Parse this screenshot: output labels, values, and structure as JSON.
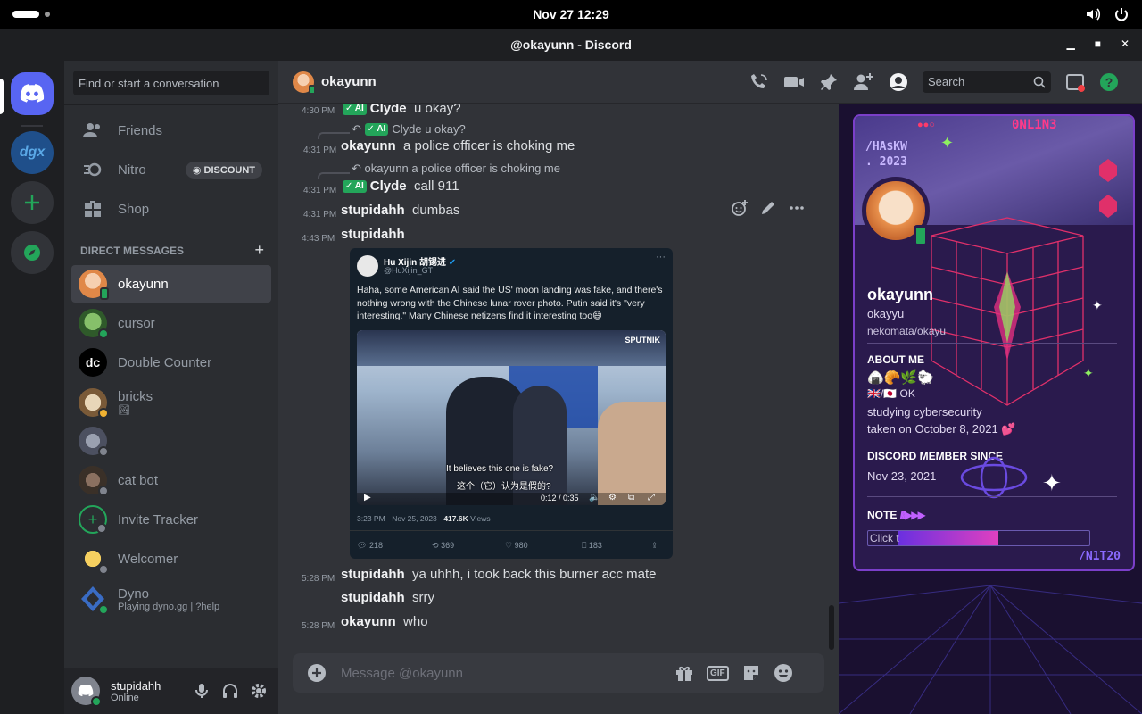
{
  "system": {
    "datetime": "Nov 27  12:29"
  },
  "window": {
    "title": "@okayunn - Discord"
  },
  "dm_sidebar": {
    "search_placeholder": "Find or start a conversation",
    "nav": [
      {
        "label": "Friends",
        "icon": "friends-icon"
      },
      {
        "label": "Nitro",
        "icon": "nitro-icon",
        "badge": "DISCOUNT"
      },
      {
        "label": "Shop",
        "icon": "shop-icon"
      }
    ],
    "dm_header": "DIRECT MESSAGES",
    "dms": [
      {
        "name": "okayunn",
        "sub": "",
        "status": "mobile",
        "color": "#f0a868"
      },
      {
        "name": "cursor",
        "sub": "",
        "status": "online",
        "color": "#3ba55c"
      },
      {
        "name": "Double Counter",
        "sub": "",
        "status": "none",
        "color": "#000000"
      },
      {
        "name": "bricks",
        "sub": "🏞",
        "status": "idle",
        "color": "#c2a37a"
      },
      {
        "name": "",
        "sub": "",
        "status": "offline",
        "color": "#6a7080"
      },
      {
        "name": "cat bot",
        "sub": "",
        "status": "offline",
        "color": "#4a4038"
      },
      {
        "name": "Invite Tracker",
        "sub": "",
        "status": "offline",
        "color": "#2b2d31"
      },
      {
        "name": "Welcomer",
        "sub": "",
        "status": "offline",
        "color": "#f0c060"
      },
      {
        "name": "Dyno",
        "sub": "Playing dyno.gg | ?help",
        "status": "online",
        "color": "#3a6cc4"
      }
    ],
    "user": {
      "name": "stupidahh",
      "status": "Online"
    }
  },
  "chat": {
    "recipient": "okayunn",
    "search_placeholder": "Search",
    "messages": {
      "m0": {
        "time": "4:30 PM",
        "author": "Clyde",
        "tag": "AI",
        "text": "u okay?"
      },
      "r1": {
        "author": "Clyde",
        "tag": "AI",
        "text": "u okay?"
      },
      "m1": {
        "time": "4:31 PM",
        "author": "okayunn",
        "text": "a police officer is choking me"
      },
      "r2": {
        "author": "okayunn",
        "text": "a police officer is choking me"
      },
      "m2": {
        "time": "4:31 PM",
        "author": "Clyde",
        "tag": "AI",
        "text": "call 911"
      },
      "m3": {
        "time": "4:31 PM",
        "author": "stupidahh",
        "text": "dumbas"
      },
      "m4": {
        "time": "4:43 PM",
        "author": "stupidahh",
        "text": ""
      },
      "m5": {
        "time": "5:28 PM",
        "author": "stupidahh",
        "text": "ya uhhh, i took back this burner acc mate"
      },
      "m6": {
        "author": "stupidahh",
        "text": "srry"
      },
      "m7": {
        "time": "5:28 PM",
        "author": "okayunn",
        "text": "who"
      }
    },
    "tweet": {
      "name": "Hu Xijin 胡锡进",
      "handle": "@HuXijin_GT",
      "text": "Haha, some American AI said the US' moon landing was fake, and there's nothing wrong with the Chinese lunar rover photo. Putin said it's \"very interesting.\" Many Chinese netizens find it interesting too😄",
      "caption_en": "It believes this one is fake?",
      "caption_zh": "这个（它）认为是假的?",
      "video_time": "0:12 / 0:35",
      "watermark": "SPUTNIK",
      "meta_time": "3:23 PM · Nov 25, 2023 · ",
      "views": "417.6K",
      "views_label": " Views",
      "replies": "218",
      "retweets": "369",
      "likes": "980",
      "bookmarks": "183"
    },
    "input_placeholder": "Message @okayunn"
  },
  "profile": {
    "deco_top_left": "/HA$KW\n. 2023",
    "deco_top_right": "0NL1N3",
    "deco_bottom_right": "/N1T20",
    "display_name": "okayunn",
    "username": "okayyu",
    "pronouns": "nekomata/okayu",
    "about_label": "ABOUT ME",
    "about_emojis": "🍙🥐🌿🐑",
    "about_flags": "🇬🇧/🇯🇵 OK",
    "about_line1": "studying cybersecurity",
    "about_line2": "taken on October 8, 2021 💕",
    "member_since_label": "DISCORD MEMBER SINCE",
    "member_since": "Nov 23, 2021",
    "note_label": "NOTE",
    "note_placeholder": "Click t"
  },
  "colors": {
    "accent": "#5865f2",
    "online": "#23a55a",
    "idle": "#f0b232",
    "offline": "#80848e",
    "profile_border": "#7b3fc9"
  }
}
